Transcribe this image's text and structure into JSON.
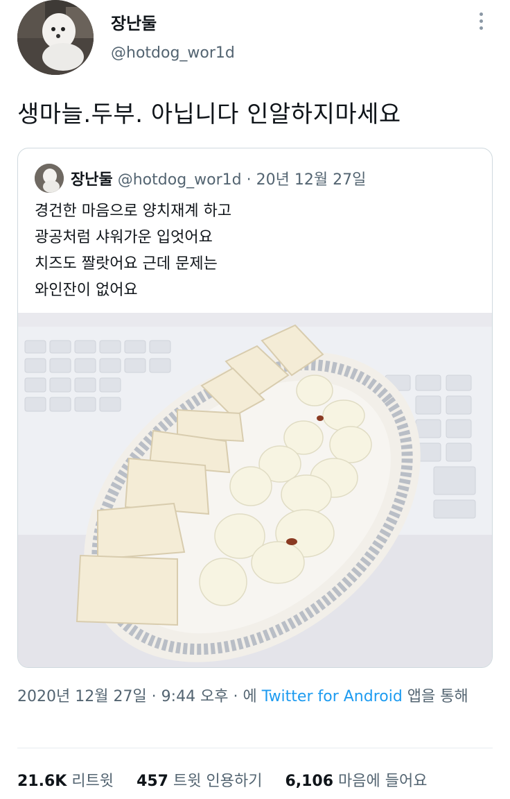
{
  "author": {
    "display_name": "장난둘",
    "handle": "@hotdog_wor1d"
  },
  "tweet": {
    "text": "생마늘.두부. 아닙니다 인알하지마세요"
  },
  "quoted_tweet": {
    "display_name": "장난둘",
    "handle": "@hotdog_wor1d",
    "separator": "·",
    "date": "20년 12월 27일",
    "lines": [
      "경건한 마음으로 양치재계 하고",
      "광공처럼 샤워가운 입엇어요",
      "치즈도 짤랏어요 근데 문제는",
      "와인잔이 없어요"
    ]
  },
  "timestamp": {
    "datetime": "2020년 12월 27일 · 9:44 오후 · 에",
    "source": "Twitter for Android",
    "suffix": "앱을 통해"
  },
  "stats": {
    "retweets_count": "21.6K",
    "retweets_label": "리트윗",
    "quotes_count": "457",
    "quotes_label": "트윗 인용하기",
    "likes_count": "6,106",
    "likes_label": "마음에 들어요"
  },
  "icons": {
    "more": "more-vertical-icon"
  },
  "colors": {
    "link": "#1d9bf0",
    "secondary_text": "#536471",
    "border": "#cfd9de"
  }
}
